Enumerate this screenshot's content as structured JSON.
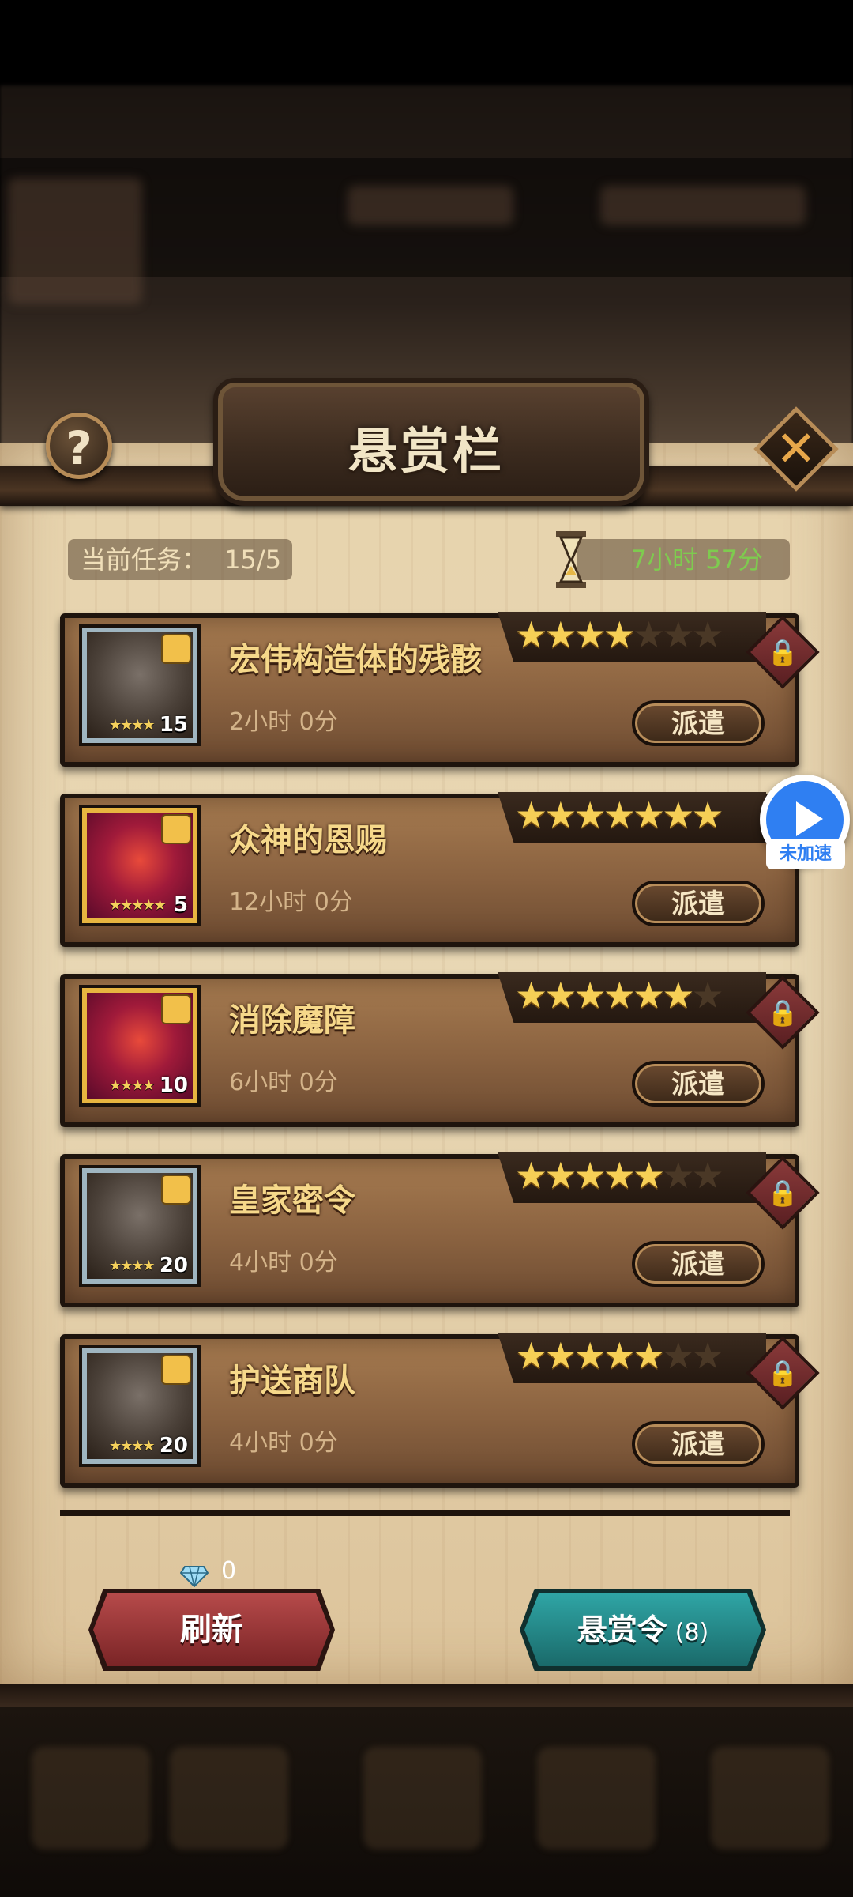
{
  "title": "悬赏栏",
  "help_label": "?",
  "close_label": "✕",
  "header": {
    "current_tasks": "当前任务：",
    "current_tasks_value": "15/5",
    "timer": "7小时 57分"
  },
  "bounties": [
    {
      "name": "宏伟构造体的残骸",
      "time": "2小时 0分",
      "stars": 4,
      "max_stars": 7,
      "hero_stars": "★★★★",
      "hero_level": "15",
      "frame": "blue",
      "dispatch": "派遣",
      "locked": true
    },
    {
      "name": "众神的恩赐",
      "time": "12小时 0分",
      "stars": 7,
      "max_stars": 7,
      "hero_stars": "★★★★★",
      "hero_level": "5",
      "frame": "gold",
      "dispatch": "派遣",
      "locked": false
    },
    {
      "name": "消除魔障",
      "time": "6小时 0分",
      "stars": 6,
      "max_stars": 7,
      "hero_stars": "★★★★",
      "hero_level": "10",
      "frame": "gold",
      "dispatch": "派遣",
      "locked": true
    },
    {
      "name": "皇家密令",
      "time": "4小时 0分",
      "stars": 5,
      "max_stars": 7,
      "hero_stars": "★★★★",
      "hero_level": "20",
      "frame": "blue",
      "dispatch": "派遣",
      "locked": true
    },
    {
      "name": "护送商队",
      "time": "4小时 0分",
      "stars": 5,
      "max_stars": 7,
      "hero_stars": "★★★★",
      "hero_level": "20",
      "frame": "blue",
      "dispatch": "派遣",
      "locked": true
    }
  ],
  "bottom": {
    "diamond_count": "0",
    "refresh_label": "刷新",
    "bounty_order_label": "悬赏令",
    "bounty_order_count": "(8)"
  },
  "overlay": {
    "accelerate_label": "未加速"
  },
  "colors": {
    "accent_gold": "#f6cf56",
    "timer_green": "#7ecb4f",
    "refresh_red": "#b64a4a",
    "bounty_teal": "#2fa5a5"
  }
}
